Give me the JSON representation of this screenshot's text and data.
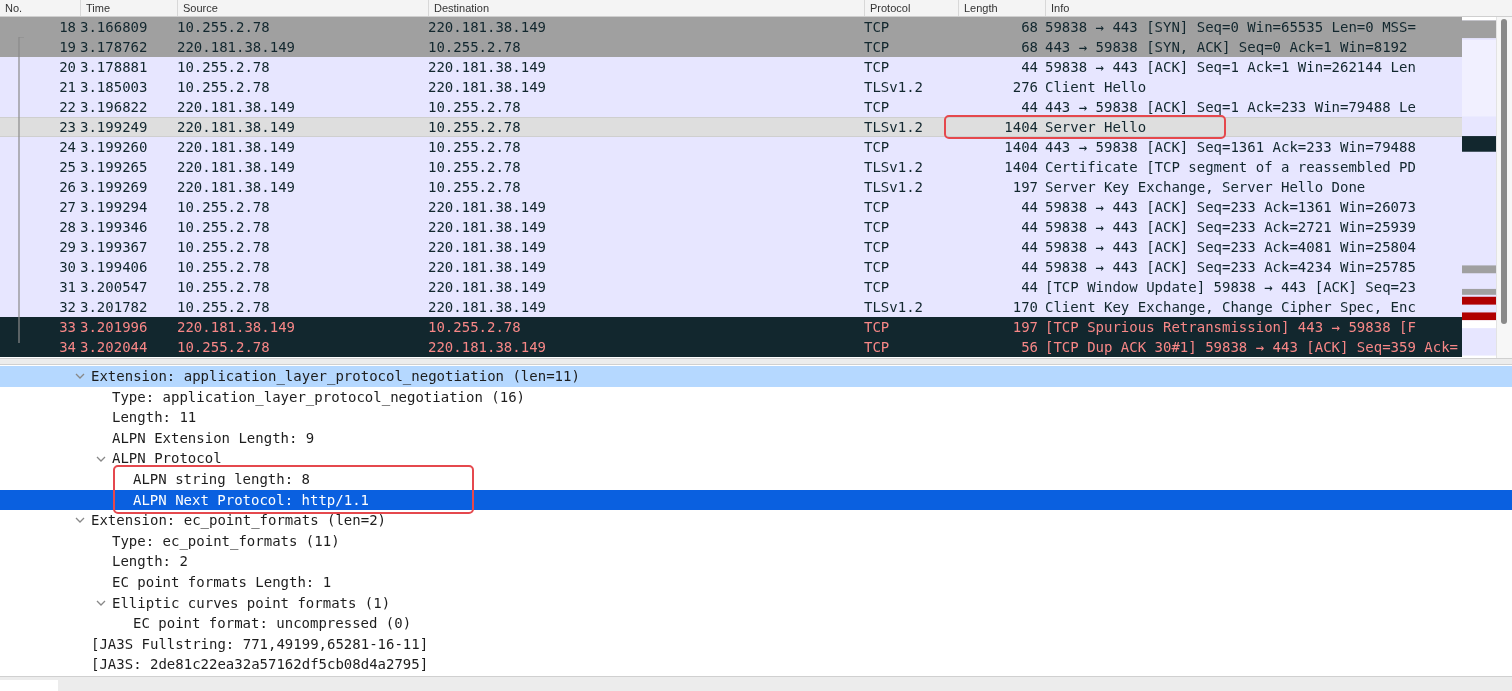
{
  "packet_list": {
    "columns": [
      "No.",
      "Time",
      "Source",
      "Destination",
      "Protocol",
      "Length",
      "Info"
    ],
    "packets": [
      {
        "no": "18",
        "time": "3.166809",
        "source": "10.255.2.78",
        "destination": "220.181.38.149",
        "protocol": "TCP",
        "length": "68",
        "info": "59838 → 443 [SYN] Seq=0 Win=65535 Len=0 MSS=",
        "color": "#a0a0a0",
        "kind": "normal",
        "selected": false,
        "boxed": false
      },
      {
        "no": "19",
        "time": "3.178762",
        "source": "220.181.38.149",
        "destination": "10.255.2.78",
        "protocol": "TCP",
        "length": "68",
        "info": "443 → 59838 [SYN, ACK] Seq=0 Ack=1 Win=8192",
        "color": "#a0a0a0",
        "kind": "normal",
        "selected": false,
        "boxed": false
      },
      {
        "no": "20",
        "time": "3.178881",
        "source": "10.255.2.78",
        "destination": "220.181.38.149",
        "protocol": "TCP",
        "length": "44",
        "info": "59838 → 443 [ACK] Seq=1 Ack=1 Win=262144 Len",
        "color": "#e7e6ff",
        "kind": "normal",
        "selected": false,
        "boxed": false
      },
      {
        "no": "21",
        "time": "3.185003",
        "source": "10.255.2.78",
        "destination": "220.181.38.149",
        "protocol": "TLSv1.2",
        "length": "276",
        "info": "Client Hello",
        "color": "#e7e6ff",
        "kind": "normal",
        "selected": false,
        "boxed": false
      },
      {
        "no": "22",
        "time": "3.196822",
        "source": "220.181.38.149",
        "destination": "10.255.2.78",
        "protocol": "TCP",
        "length": "44",
        "info": "443 → 59838 [ACK] Seq=1 Ack=233 Win=79488 Le",
        "color": "#e7e6ff",
        "kind": "normal",
        "selected": false,
        "boxed": false
      },
      {
        "no": "23",
        "time": "3.199249",
        "source": "220.181.38.149",
        "destination": "10.255.2.78",
        "protocol": "TLSv1.2",
        "length": "1404",
        "info": "Server Hello",
        "color": "#dedede",
        "kind": "normal",
        "selected": true,
        "boxed": true
      },
      {
        "no": "24",
        "time": "3.199260",
        "source": "220.181.38.149",
        "destination": "10.255.2.78",
        "protocol": "TCP",
        "length": "1404",
        "info": "443 → 59838 [ACK] Seq=1361 Ack=233 Win=79488",
        "color": "#e7e6ff",
        "kind": "normal",
        "selected": false,
        "boxed": false
      },
      {
        "no": "25",
        "time": "3.199265",
        "source": "220.181.38.149",
        "destination": "10.255.2.78",
        "protocol": "TLSv1.2",
        "length": "1404",
        "info": "Certificate [TCP segment of a reassembled PD",
        "color": "#e7e6ff",
        "kind": "normal",
        "selected": false,
        "boxed": false
      },
      {
        "no": "26",
        "time": "3.199269",
        "source": "220.181.38.149",
        "destination": "10.255.2.78",
        "protocol": "TLSv1.2",
        "length": "197",
        "info": "Server Key Exchange, Server Hello Done",
        "color": "#e7e6ff",
        "kind": "normal",
        "selected": false,
        "boxed": false
      },
      {
        "no": "27",
        "time": "3.199294",
        "source": "10.255.2.78",
        "destination": "220.181.38.149",
        "protocol": "TCP",
        "length": "44",
        "info": "59838 → 443 [ACK] Seq=233 Ack=1361 Win=26073",
        "color": "#e7e6ff",
        "kind": "normal",
        "selected": false,
        "boxed": false
      },
      {
        "no": "28",
        "time": "3.199346",
        "source": "10.255.2.78",
        "destination": "220.181.38.149",
        "protocol": "TCP",
        "length": "44",
        "info": "59838 → 443 [ACK] Seq=233 Ack=2721 Win=25939",
        "color": "#e7e6ff",
        "kind": "normal",
        "selected": false,
        "boxed": false
      },
      {
        "no": "29",
        "time": "3.199367",
        "source": "10.255.2.78",
        "destination": "220.181.38.149",
        "protocol": "TCP",
        "length": "44",
        "info": "59838 → 443 [ACK] Seq=233 Ack=4081 Win=25804",
        "color": "#e7e6ff",
        "kind": "normal",
        "selected": false,
        "boxed": false
      },
      {
        "no": "30",
        "time": "3.199406",
        "source": "10.255.2.78",
        "destination": "220.181.38.149",
        "protocol": "TCP",
        "length": "44",
        "info": "59838 → 443 [ACK] Seq=233 Ack=4234 Win=25785",
        "color": "#e7e6ff",
        "kind": "normal",
        "selected": false,
        "boxed": false
      },
      {
        "no": "31",
        "time": "3.200547",
        "source": "10.255.2.78",
        "destination": "220.181.38.149",
        "protocol": "TCP",
        "length": "44",
        "info": "[TCP Window Update] 59838 → 443 [ACK] Seq=23",
        "color": "#e7e6ff",
        "kind": "normal",
        "selected": false,
        "boxed": false
      },
      {
        "no": "32",
        "time": "3.201782",
        "source": "10.255.2.78",
        "destination": "220.181.38.149",
        "protocol": "TLSv1.2",
        "length": "170",
        "info": "Client Key Exchange, Change Cipher Spec, Enc",
        "color": "#e7e6ff",
        "kind": "normal",
        "selected": false,
        "boxed": false
      },
      {
        "no": "33",
        "time": "3.201996",
        "source": "220.181.38.149",
        "destination": "10.255.2.78",
        "protocol": "TCP",
        "length": "197",
        "info": "[TCP Spurious Retransmission] 443 → 59838 [F",
        "color": "#12272e",
        "kind": "error",
        "selected": false,
        "boxed": false
      },
      {
        "no": "34",
        "time": "3.202044",
        "source": "10.255.2.78",
        "destination": "220.181.38.149",
        "protocol": "TCP",
        "length": "56",
        "info": "[TCP Dup ACK 30#1] 59838 → 443 [ACK] Seq=359 Ack=",
        "color": "#12272e",
        "kind": "error",
        "selected": false,
        "boxed": false
      }
    ]
  },
  "details": [
    {
      "text": "Extension: application_layer_protocol_negotiation (len=11)",
      "expanded": true,
      "selected": false,
      "highlighted": true,
      "children": [
        {
          "text": "Type: application_layer_protocol_negotiation (16)",
          "selected": false,
          "highlighted": false
        },
        {
          "text": "Length: 11",
          "selected": false,
          "highlighted": false
        },
        {
          "text": "ALPN Extension Length: 9",
          "selected": false,
          "highlighted": false
        },
        {
          "text": "ALPN Protocol",
          "expanded": true,
          "selected": false,
          "highlighted": false,
          "children": [
            {
              "text": "ALPN string length: 8",
              "selected": false,
              "highlighted": false,
              "boxed": true
            },
            {
              "text": "ALPN Next Protocol: http/1.1",
              "selected": true,
              "boxed": true
            }
          ]
        }
      ]
    },
    {
      "text": "Extension: ec_point_formats (len=2)",
      "expanded": true,
      "selected": false,
      "highlighted": false,
      "children": [
        {
          "text": "Type: ec_point_formats (11)",
          "selected": false,
          "highlighted": false
        },
        {
          "text": "Length: 2",
          "selected": false,
          "highlighted": false
        },
        {
          "text": "EC point formats Length: 1",
          "selected": false,
          "highlighted": false
        },
        {
          "text": "Elliptic curves point formats (1)",
          "expanded": true,
          "selected": false,
          "highlighted": false,
          "children": [
            {
              "text": "EC point format: uncompressed (0)",
              "selected": false,
              "highlighted": false
            }
          ]
        }
      ]
    },
    {
      "text": "[JA3S Fullstring: 771,49199,65281-16-11]",
      "selected": false,
      "highlighted": false
    },
    {
      "text": "[JA3S: 2de81c22ea32a57162df5cb08d4a2795]",
      "selected": false,
      "highlighted": false
    }
  ]
}
